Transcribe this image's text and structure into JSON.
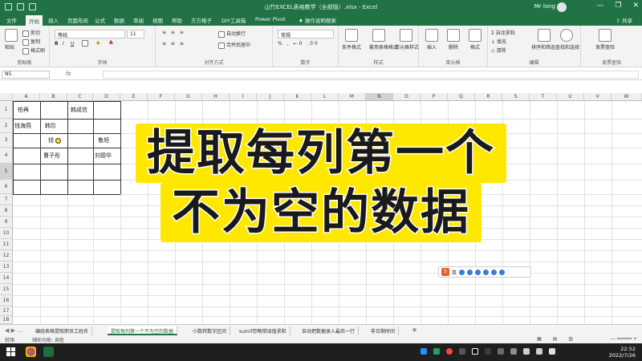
{
  "window": {
    "title": "山竹EXCEL表格教学（全部版）.xlsx - Excel",
    "user": "Mr long",
    "controls": [
      "—",
      "❐",
      "✕"
    ]
  },
  "ribbon_tabs": [
    "文件",
    "开始",
    "插入",
    "页面布局",
    "公式",
    "数据",
    "审阅",
    "视图",
    "帮助",
    "方方格子",
    "DIY工具箱",
    "Power Pivot",
    "操作说明搜索"
  ],
  "active_tab": "开始",
  "share_label": "共享",
  "ribbon": {
    "clipboard": {
      "label": "剪贴板",
      "paste": "粘贴",
      "cut": "剪切",
      "copy": "复制",
      "format_painter": "格式刷"
    },
    "font": {
      "label": "字体",
      "font_name": "等线",
      "font_size": "11"
    },
    "alignment": {
      "label": "对齐方式",
      "wrap": "自动换行",
      "merge": "合并后居中"
    },
    "number": {
      "label": "数字",
      "format": "常规"
    },
    "styles": {
      "label": "样式",
      "conditional": "条件格式",
      "table": "套用表格格式",
      "cell_styles": "单元格样式"
    },
    "cells": {
      "label": "单元格",
      "insert": "插入",
      "delete": "删除",
      "format": "格式"
    },
    "editing": {
      "label": "编辑",
      "autosum": "自动求和",
      "fill": "填充",
      "clear": "清除",
      "sort": "排序和筛选",
      "find": "查找和选择"
    },
    "invoice": {
      "label": "发票查验",
      "btn": "发票查验"
    }
  },
  "formula_bar": {
    "name_box": "N5",
    "fx": "fx",
    "value": ""
  },
  "columns": [
    "A",
    "B",
    "C",
    "D",
    "E",
    "F",
    "G",
    "H",
    "I",
    "J",
    "K",
    "L",
    "M",
    "N",
    "O",
    "P",
    "Q",
    "R",
    "S",
    "T",
    "U",
    "V",
    "W"
  ],
  "rows": [
    "1",
    "2",
    "3",
    "4",
    "5",
    "6",
    "7",
    "8",
    "9",
    "10",
    "11",
    "12",
    "13",
    "14",
    "15",
    "16",
    "17",
    "18"
  ],
  "cells": {
    "A1": "柏再",
    "C1": "韩成信",
    "A2": "钱海燕",
    "B2": "韩珍",
    "B3": "钱",
    "D3": "鲁旭",
    "B4": "曹子彤",
    "D4": "刘德华"
  },
  "overlay": {
    "line1": "提取每列第一个",
    "line2": "不为空的数据"
  },
  "ime": {
    "logo": "S",
    "lang": "英"
  },
  "sheet_tabs": [
    "编组表格提取职员工姓名",
    "提取每列第一个不为空的数据",
    "小数转数字区间",
    "sumif忽略错误值求和",
    "自动把数据录入最后一行",
    "非日期时间"
  ],
  "active_sheet": 1,
  "status": {
    "ready": "就绪",
    "accessibility": "辅助功能: 调查"
  },
  "clock": {
    "time": "22:52",
    "date": "2022/7/26"
  }
}
